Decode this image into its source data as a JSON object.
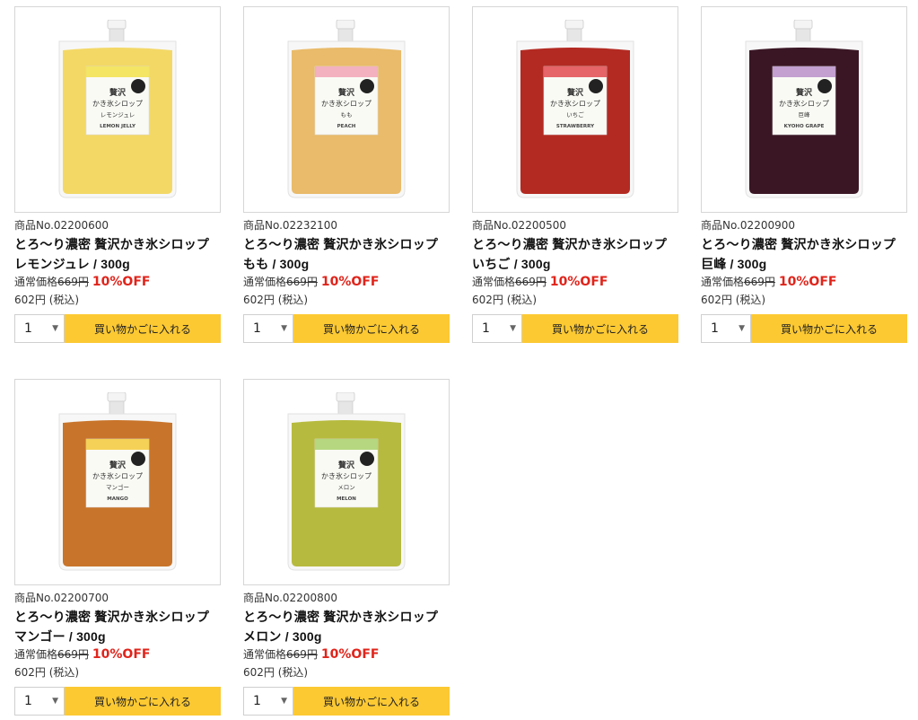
{
  "labels": {
    "regular_price_prefix": "通常価格",
    "discount": "10%OFF",
    "add_to_cart": "買い物かごに入れる",
    "tax_suffix": "(税込)"
  },
  "products": [
    {
      "number": "商品No.02200600",
      "title_line1": "とろ～り濃密 贅沢かき氷シロップ",
      "title_line2": "レモンジュレ / 300g",
      "regular_price": "669円",
      "sale_price": "602円",
      "qty": "1",
      "label_text": "レモンジュレ",
      "label_en": "LEMON JELLY",
      "colors": {
        "liquid": "#f3d866",
        "liquid_dark": "#e8c23a",
        "label_accent": "#f2e14a"
      }
    },
    {
      "number": "商品No.02232100",
      "title_line1": "とろ～り濃密 贅沢かき氷シロップ",
      "title_line2": "もも / 300g",
      "regular_price": "669円",
      "sale_price": "602円",
      "qty": "1",
      "label_text": "もも",
      "label_en": "PEACH",
      "colors": {
        "liquid": "#e9bb6a",
        "liquid_dark": "#d89f48",
        "label_accent": "#f1a3b5"
      }
    },
    {
      "number": "商品No.02200500",
      "title_line1": "とろ～り濃密 贅沢かき氷シロップ",
      "title_line2": "いちご / 300g",
      "regular_price": "669円",
      "sale_price": "602円",
      "qty": "1",
      "label_text": "いちご",
      "label_en": "STRAWBERRY",
      "colors": {
        "liquid": "#b32a22",
        "liquid_dark": "#8f1c16",
        "label_accent": "#e04a50"
      }
    },
    {
      "number": "商品No.02200900",
      "title_line1": "とろ～り濃密 贅沢かき氷シロップ",
      "title_line2": "巨峰 / 300g",
      "regular_price": "669円",
      "sale_price": "602円",
      "qty": "1",
      "label_text": "巨峰",
      "label_en": "KYOHO GRAPE",
      "colors": {
        "liquid": "#3a1624",
        "liquid_dark": "#220b14",
        "label_accent": "#b98fc9"
      }
    },
    {
      "number": "商品No.02200700",
      "title_line1": "とろ～り濃密 贅沢かき氷シロップ",
      "title_line2": "マンゴー / 300g",
      "regular_price": "669円",
      "sale_price": "602円",
      "qty": "1",
      "label_text": "マンゴー",
      "label_en": "MANGO",
      "colors": {
        "liquid": "#c8742a",
        "liquid_dark": "#a8561a",
        "label_accent": "#f4c93b"
      }
    },
    {
      "number": "商品No.02200800",
      "title_line1": "とろ～り濃密 贅沢かき氷シロップ",
      "title_line2": "メロン / 300g",
      "regular_price": "669円",
      "sale_price": "602円",
      "qty": "1",
      "label_text": "メロン",
      "label_en": "MELON",
      "colors": {
        "liquid": "#b6ba3e",
        "liquid_dark": "#93962a",
        "label_accent": "#a9d06a"
      }
    }
  ]
}
